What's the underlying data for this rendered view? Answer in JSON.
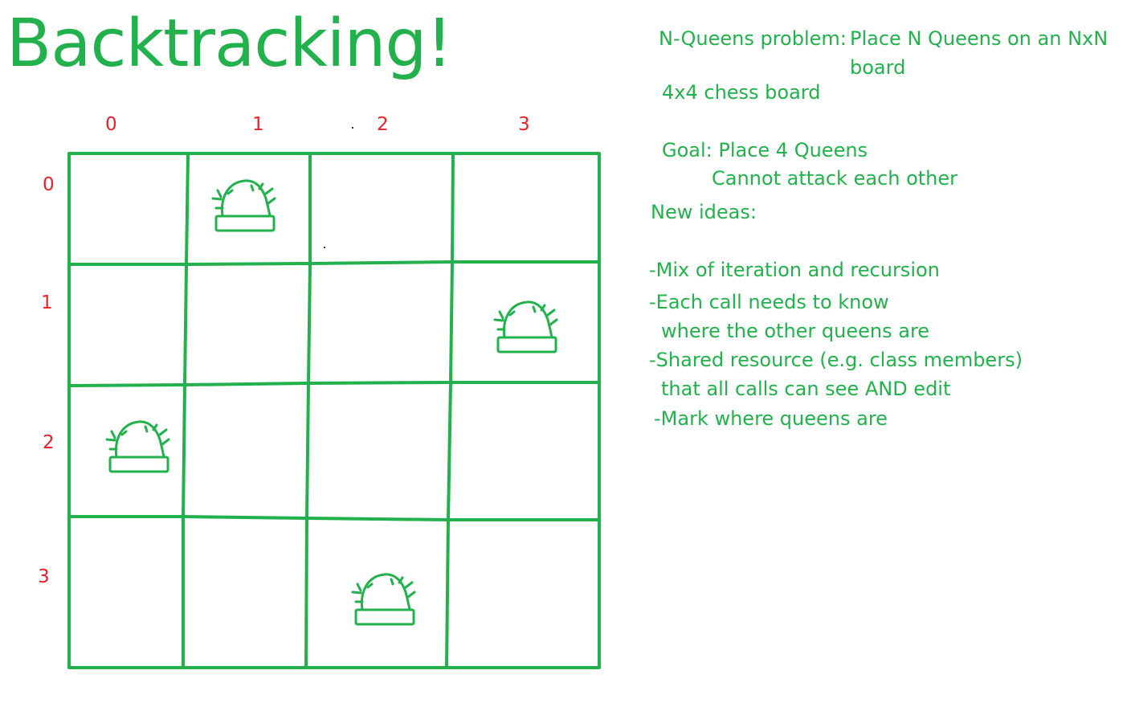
{
  "title": "Backtracking!",
  "board": {
    "col_labels": [
      "0",
      "1",
      "2",
      "3"
    ],
    "row_labels": [
      "0",
      "1",
      "2",
      "3"
    ],
    "queens": [
      {
        "row": 0,
        "col": 1
      },
      {
        "row": 1,
        "col": 3
      },
      {
        "row": 2,
        "col": 0
      },
      {
        "row": 3,
        "col": 2
      }
    ]
  },
  "notes": {
    "problem_label": "N-Queens problem:",
    "problem_text_1": "Place N Queens on an NxN",
    "problem_text_2": "board",
    "board_size": "4x4 chess board",
    "goal_label": "Goal: Place 4 Queens",
    "goal_detail": "Cannot attack each other",
    "new_ideas": "New ideas:",
    "ideas": [
      "-Mix of iteration and  recursion",
      "-Each call needs to know",
      "where the other queens are",
      "-Shared resource (e.g. class members)",
      "that all calls can see AND edit",
      "-Mark where queens are"
    ]
  },
  "colors": {
    "ink": "#22b14c",
    "labels": "#e8202a"
  }
}
